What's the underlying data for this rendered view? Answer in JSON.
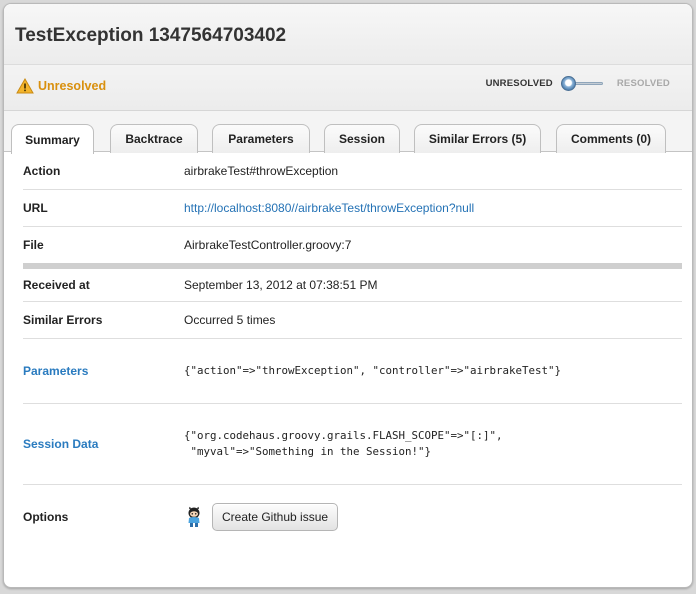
{
  "title": "TestException 1347564703402",
  "status": {
    "label": "Unresolved",
    "color": "#d9900e",
    "toggle_left": "UNRESOLVED",
    "toggle_right": "RESOLVED",
    "state": "unresolved"
  },
  "tabs": [
    {
      "label": "Summary",
      "active": true
    },
    {
      "label": "Backtrace"
    },
    {
      "label": "Parameters"
    },
    {
      "label": "Session"
    },
    {
      "label": "Similar Errors (5)"
    },
    {
      "label": "Comments (0)"
    }
  ],
  "rows": {
    "action": {
      "label": "Action",
      "value": "airbrakeTest#throwException"
    },
    "url": {
      "label": "URL",
      "value": "http://localhost:8080//airbrakeTest/throwException?null"
    },
    "file": {
      "label": "File",
      "value": "AirbrakeTestController.groovy:7"
    },
    "received": {
      "label": "Received at",
      "value": "September 13, 2012 at 07:38:51 PM"
    },
    "similar": {
      "label": "Similar Errors",
      "value": "Occurred 5 times"
    },
    "parameters": {
      "label": "Parameters",
      "value": "{\"action\"=>\"throwException\", \"controller\"=>\"airbrakeTest\"}"
    },
    "session": {
      "label": "Session Data",
      "value": "{\"org.codehaus.groovy.grails.FLASH_SCOPE\"=>\"[:]\",\n \"myval\"=>\"Something in the Session!\"}"
    },
    "options": {
      "label": "Options",
      "button_label": "Create Github issue"
    }
  },
  "colors": {
    "link": "#2472b5",
    "warning": "#d9900e"
  }
}
